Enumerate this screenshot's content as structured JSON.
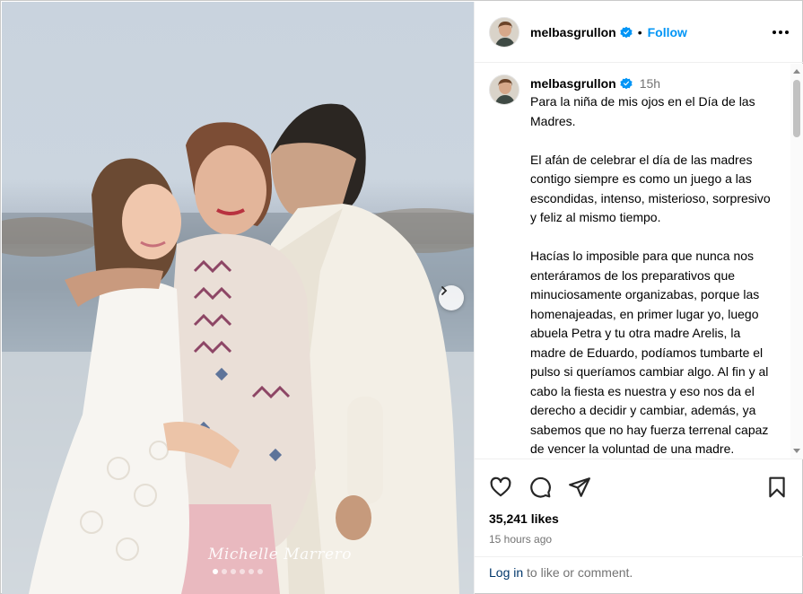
{
  "post": {
    "username": "melbasgrullon",
    "follow_label": "Follow",
    "separator": "•",
    "time_ago": "15h",
    "caption": [
      "Para la niña de mis ojos en el Día de las Madres.",
      "El afán de celebrar el día de las madres contigo siempre es como un juego a las escondidas, intenso, misterioso, sorpresivo y feliz al mismo tiempo.",
      "Hacías lo imposible para que nunca nos enteráramos de los preparativos que minuciosamente organizabas, porque las homenajeadas, en primer lugar yo, luego abuela Petra y tu otra madre Arelis, la madre de Eduardo, podíamos tumbarte el pulso si queríamos cambiar algo. Al fin y al cabo la fiesta es nuestra y eso nos da el derecho a decidir y cambiar, además, ya sabemos que no hay fuerza terrenal capaz de vencer la voluntad de una madre."
    ],
    "likes": "35,241 likes",
    "posted": "15 hours ago",
    "login_link": "Log in",
    "login_suffix": " to like or comment."
  },
  "photo": {
    "watermark": "Michelle Marrero",
    "carousel_count": 6,
    "carousel_active": 0
  },
  "icons": {
    "verified": "verified-badge-icon",
    "more": "more-options-icon",
    "like": "heart-icon",
    "comment": "comment-icon",
    "share": "paper-plane-icon",
    "save": "bookmark-icon",
    "next": "chevron-right-icon"
  },
  "colors": {
    "link_blue": "#0095f6",
    "login_blue": "#00376b",
    "muted_text": "#737373",
    "border": "#efefef"
  }
}
